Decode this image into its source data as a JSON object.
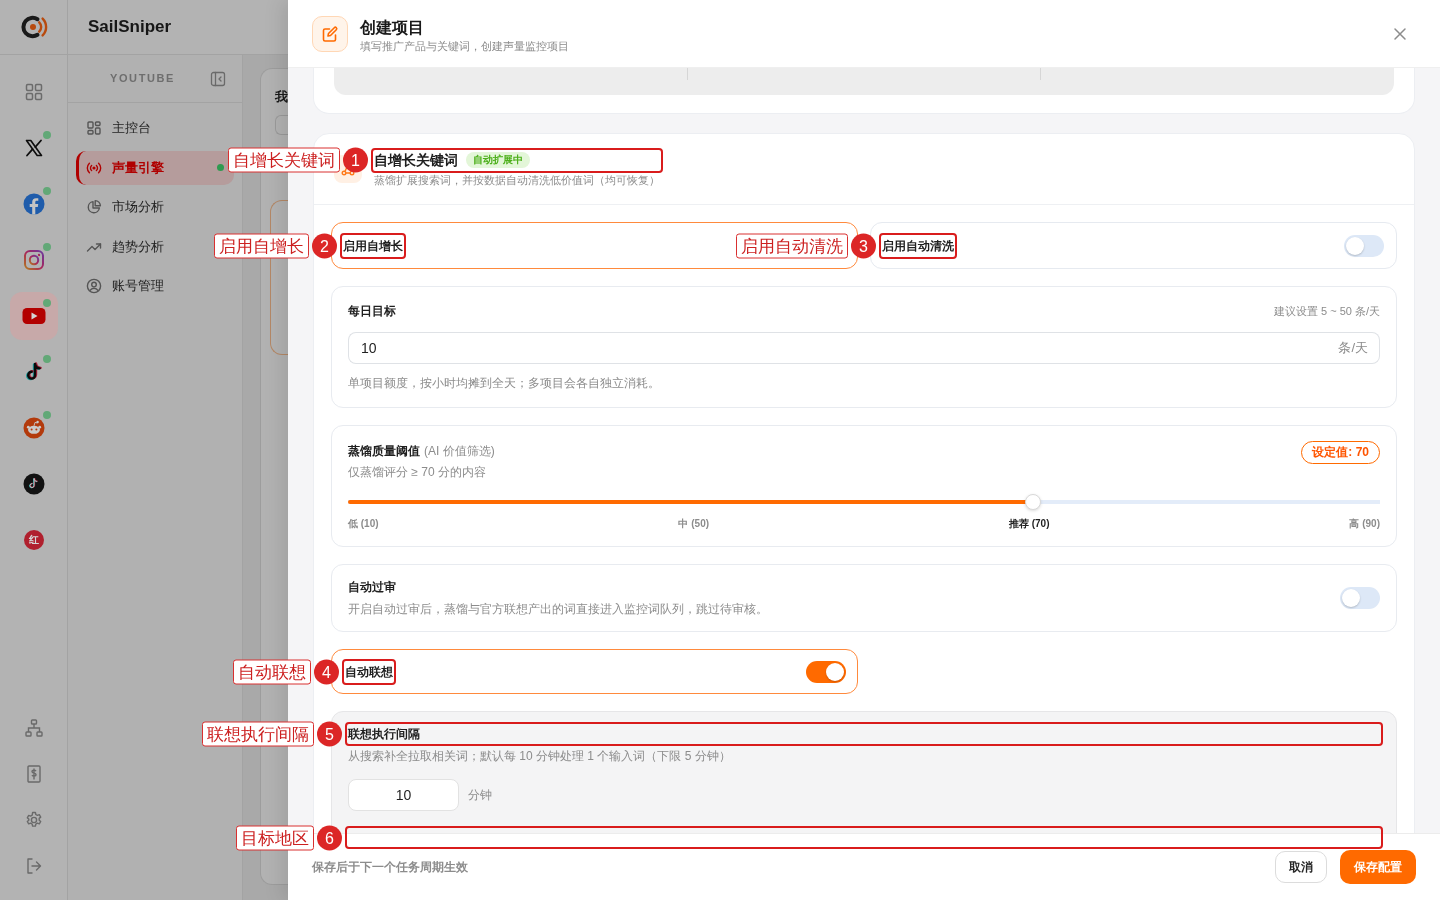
{
  "app": {
    "brand": "SailSniper",
    "rail": {
      "items": [
        {
          "kind": "grid",
          "selected": false,
          "online": false
        },
        {
          "kind": "x",
          "selected": false,
          "online": true
        },
        {
          "kind": "facebook",
          "selected": false,
          "online": true
        },
        {
          "kind": "instagram",
          "selected": false,
          "online": true
        },
        {
          "kind": "youtube",
          "selected": true,
          "online": true
        },
        {
          "kind": "tiktok",
          "selected": false,
          "online": true
        },
        {
          "kind": "reddit",
          "selected": false,
          "online": true
        },
        {
          "kind": "tiktok_round",
          "selected": false,
          "online": false
        },
        {
          "kind": "xhs",
          "selected": false,
          "online": false,
          "glyph": "红"
        }
      ],
      "bottom_items": [
        {
          "kind": "sitemap"
        },
        {
          "kind": "billing"
        },
        {
          "kind": "settings"
        },
        {
          "kind": "logout"
        }
      ]
    },
    "nav": {
      "section": "YOUTUBE",
      "items": [
        {
          "label": "主控台",
          "kind": "dashboard",
          "selected": false,
          "running": false
        },
        {
          "label": "声量引擎",
          "kind": "broadcast",
          "selected": true,
          "running": true
        },
        {
          "label": "市场分析",
          "kind": "pie",
          "selected": false,
          "running": false
        },
        {
          "label": "趋势分析",
          "kind": "trend",
          "selected": false,
          "running": false
        },
        {
          "label": "账号管理",
          "kind": "account",
          "selected": false,
          "running": false
        }
      ]
    },
    "background_card": {
      "title": "我"
    }
  },
  "drawer": {
    "title": "创建项目",
    "subtitle": "填写推广产品与关键词，创建声量监控项目",
    "keywords": {
      "title": "自增长关键词",
      "badge": "自动扩展中",
      "subtitle": "蒸馏扩展搜索词，并按数据自动清洗低价值词（均可恢复）",
      "toggles": [
        {
          "kind": "plain",
          "label": "启用自增长",
          "on": true
        },
        {
          "kind": "switch",
          "label": "启用自动清洗",
          "on": false
        }
      ],
      "daily_target": {
        "title": "每日目标",
        "hint": "建议设置 5 ~ 50 条/天",
        "value": "10",
        "unit": "条/天",
        "help": "单项目额度，按小时均摊到全天；多项目会各自独立消耗。"
      },
      "quality": {
        "title": "蒸馏质量阈值",
        "title_note": "(AI 价值筛选)",
        "subtitle": "仅蒸馏评分 ≥ 70 分的内容",
        "badge": "设定值: 70",
        "level": 0.664,
        "scale": [
          {
            "label": "低 (10)",
            "selected": false
          },
          {
            "label": "中 (50)",
            "selected": false
          },
          {
            "label": "推荐 (70)",
            "selected": true
          },
          {
            "label": "高 (90)",
            "selected": false
          }
        ]
      },
      "auto_review": {
        "title": "自动过审",
        "description": "开启自动过审后，蒸馏与官方联想产出的词直接进入监控词队列，跳过待审核。",
        "on": false
      },
      "auto_suggest": {
        "label": "自动联想",
        "on": true
      },
      "suggest_interval": {
        "title": "联想执行间隔",
        "description": "从搜索补全拉取相关词；默认每 10 分钟处理 1 个输入词（下限 5 分钟）",
        "value": "10",
        "unit": "分钟"
      }
    },
    "footer": {
      "note": "保存后于下一个任务周期生效",
      "buttons": [
        {
          "label": "取消",
          "kind": "secondary"
        },
        {
          "label": "保存配置",
          "kind": "primary"
        }
      ]
    }
  },
  "annotations": [
    {
      "number": "1",
      "label": "自增长关键词"
    },
    {
      "number": "2",
      "label": "启用自增长"
    },
    {
      "number": "3",
      "label": "启用自动清洗"
    },
    {
      "number": "4",
      "label": "自动联想"
    },
    {
      "number": "5",
      "label": "联想执行间隔"
    },
    {
      "number": "6",
      "label": "目标地区"
    }
  ]
}
